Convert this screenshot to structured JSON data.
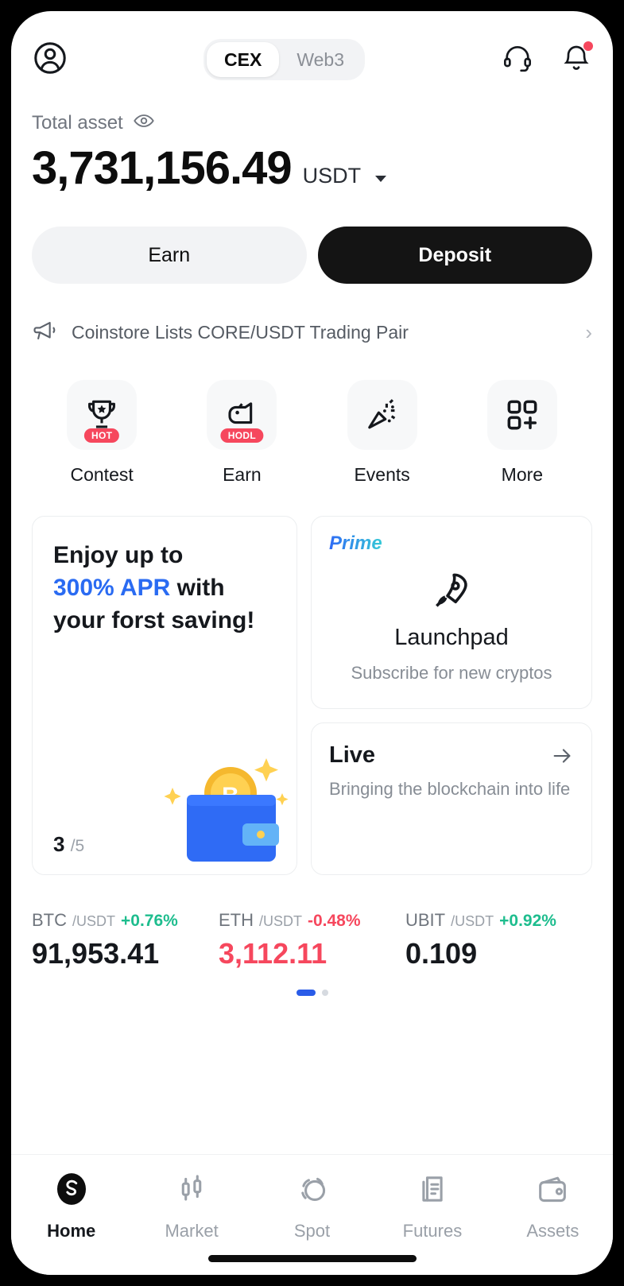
{
  "header": {
    "profile_icon": "user-circle-icon",
    "tabs": [
      {
        "label": "CEX",
        "active": true
      },
      {
        "label": "Web3",
        "active": false
      }
    ],
    "support_icon": "headset-icon",
    "notification_icon": "bell-icon",
    "has_notification": true
  },
  "asset": {
    "label": "Total asset",
    "eye_icon": "eye-icon",
    "amount": "3,731,156.49",
    "currency": "USDT",
    "currency_caret": "chevron-down-icon"
  },
  "actions": {
    "earn_label": "Earn",
    "deposit_label": "Deposit"
  },
  "announcement": {
    "icon": "megaphone-icon",
    "text": "Coinstore Lists CORE/USDT Trading Pair",
    "chevron": "›"
  },
  "quick_actions": [
    {
      "label": "Contest",
      "icon": "trophy-icon",
      "badge": "HOT"
    },
    {
      "label": "Earn",
      "icon": "piggy-hodl-icon",
      "badge": "HODL"
    },
    {
      "label": "Events",
      "icon": "confetti-icon",
      "badge": ""
    },
    {
      "label": "More",
      "icon": "grid-plus-icon",
      "badge": ""
    }
  ],
  "promo_card": {
    "line1": "Enjoy up to",
    "highlight": "300% APR",
    "line2_rest": " with",
    "line3": "your forst saving!",
    "current": "3",
    "total": "/5",
    "art": "wallet-bitcoin-illustration"
  },
  "launchpad_card": {
    "tag": "Prime",
    "icon": "rocket-icon",
    "title": "Launchpad",
    "subtitle": "Subscribe for new cryptos"
  },
  "live_card": {
    "title": "Live",
    "subtitle": "Bringing the blockchain into life",
    "arrow_icon": "arrow-right-icon"
  },
  "tickers": [
    {
      "base": "BTC",
      "quote": "/USDT",
      "change": "+0.76%",
      "direction": "up",
      "price": "91,953.41",
      "price_color": "neutral"
    },
    {
      "base": "ETH",
      "quote": "/USDT",
      "change": "-0.48%",
      "direction": "down",
      "price": "3,112.11",
      "price_color": "red"
    },
    {
      "base": "UBIT",
      "quote": "/USDT",
      "change": "+0.92%",
      "direction": "up",
      "price": "0.109",
      "price_color": "neutral"
    }
  ],
  "pagination": {
    "active_index": 0,
    "count": 2
  },
  "bottom_nav": [
    {
      "label": "Home",
      "icon": "home-logo-icon",
      "active": true
    },
    {
      "label": "Market",
      "icon": "candlestick-icon",
      "active": false
    },
    {
      "label": "Spot",
      "icon": "swap-circles-icon",
      "active": false
    },
    {
      "label": "Futures",
      "icon": "document-chart-icon",
      "active": false
    },
    {
      "label": "Assets",
      "icon": "wallet-icon",
      "active": false
    }
  ],
  "colors": {
    "accent_blue": "#2a6bf2",
    "up_green": "#1ebd8e",
    "down_red": "#f6475d",
    "badge_red": "#f6475d",
    "dark": "#141414"
  }
}
